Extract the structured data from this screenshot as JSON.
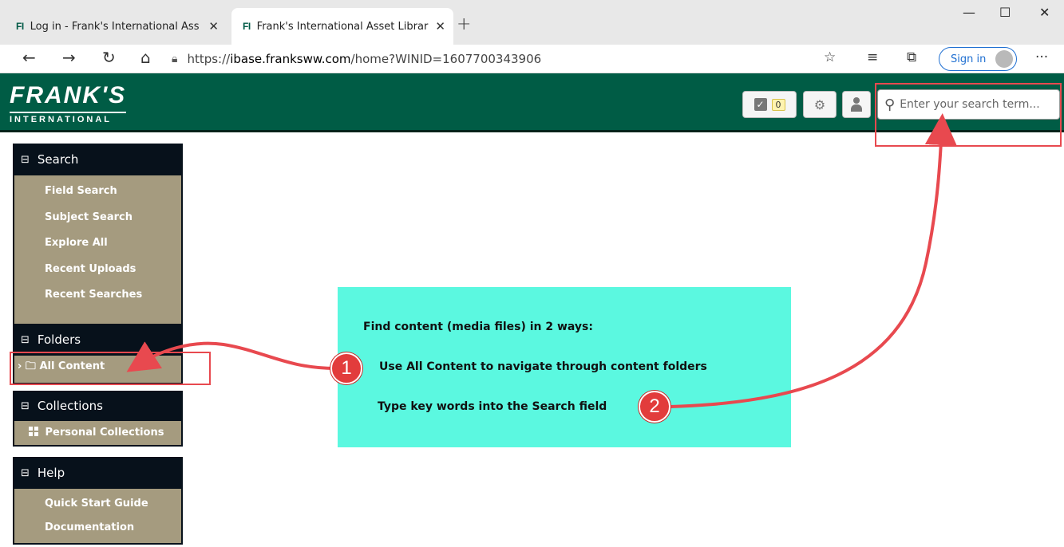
{
  "browser": {
    "tabs": [
      {
        "favicon": "FI",
        "title": "Log in - Frank's International Ass"
      },
      {
        "favicon": "FI",
        "title": "Frank's International Asset Librar"
      }
    ],
    "newtab_glyph": "+",
    "window_controls": {
      "minimize": "—",
      "maximize": "☐",
      "close": "✕"
    },
    "nav": {
      "back": "←",
      "forward": "→",
      "reload": "↻",
      "home": "⌂"
    },
    "url_scheme": "https://",
    "url_host": "ibase.franksww.com",
    "url_path": "/home?WINID=1607700343906",
    "toolbar_icons": [
      "favorite-add-icon",
      "favorites-icon",
      "collections-icon",
      "more-icon"
    ],
    "sign_in_label": "Sign in"
  },
  "header": {
    "logo_line1": "FRANK'S",
    "logo_line2": "INTERNATIONAL",
    "task_count": "0",
    "search_placeholder": "Enter your search term..."
  },
  "sidebar": {
    "search": {
      "title": "Search",
      "items": [
        "Field Search",
        "Subject Search",
        "Explore All",
        "Recent Uploads",
        "Recent Searches"
      ]
    },
    "folders": {
      "title": "Folders",
      "items": [
        "All Content"
      ]
    },
    "collections": {
      "title": "Collections",
      "items": [
        "Personal Collections"
      ]
    },
    "help": {
      "title": "Help",
      "items": [
        "Quick Start Guide",
        "Documentation"
      ]
    }
  },
  "callout": {
    "heading": "Find content (media files) in 2 ways:",
    "step1": "Use All Content to navigate through content folders",
    "step2": "Type key words into the Search field",
    "marker1": "1",
    "marker2": "2"
  },
  "colors": {
    "header_green": "#005c45",
    "panel_dark": "#07111b",
    "panel_tan": "#a59b7f",
    "callout_cyan": "#5bf8e0",
    "annotation_red": "#e8494f"
  }
}
